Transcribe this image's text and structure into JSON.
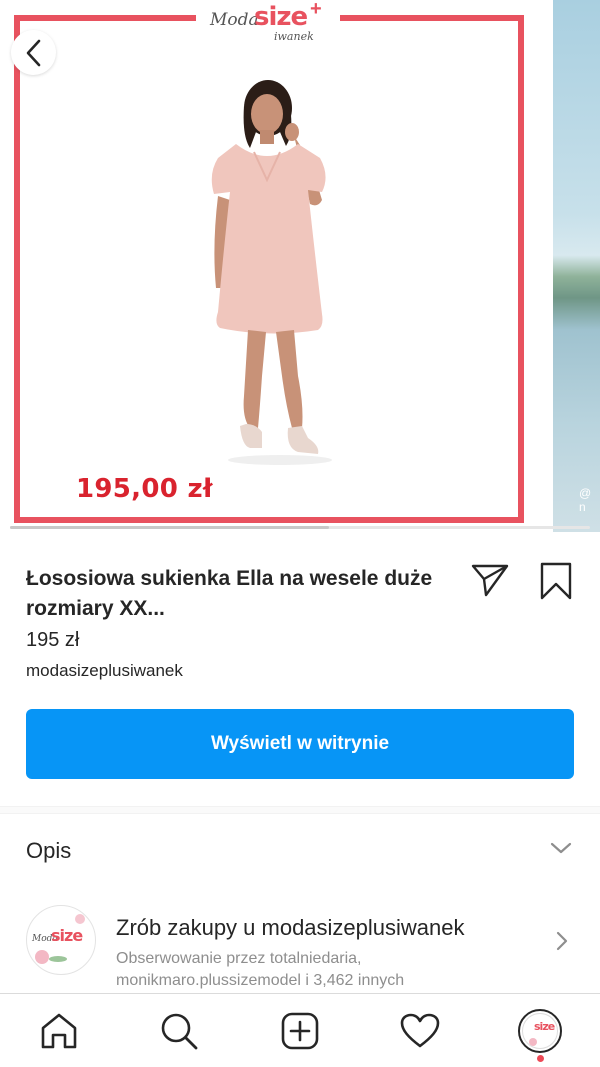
{
  "carousel": {
    "brand_logo": {
      "moda": "Moda",
      "size": "size",
      "plus": "+",
      "sub": "iwanek"
    },
    "price_overlay": "195,00 zł",
    "next_slide_watermark": "@ n",
    "current_slide": 1,
    "progress_fraction": 0.55
  },
  "product": {
    "title": "Łososiowa sukienka Ella na wesele duże rozmiary XX...",
    "price": "195 zł",
    "seller": "modasizeplusiwanek",
    "cta_label": "Wyświetl w witrynie"
  },
  "description": {
    "label": "Opis"
  },
  "shop": {
    "title": "Zrób zakupy u modasizeplusiwanek",
    "subtitle": "Obserwowanie przez totalniedaria, monikmaro.plussizemodel i 3,462 innych",
    "avatar": {
      "moda": "Moda",
      "size": "size"
    }
  },
  "nav": {
    "items": [
      "home-icon",
      "search-icon",
      "new-post-icon",
      "activity-heart-icon",
      "profile-avatar"
    ],
    "profile_avatar_text": "size",
    "notification_color": "#ed4956"
  },
  "colors": {
    "accent": "#0795f6",
    "frame": "#e8525f",
    "price_overlay": "#d9232e"
  }
}
